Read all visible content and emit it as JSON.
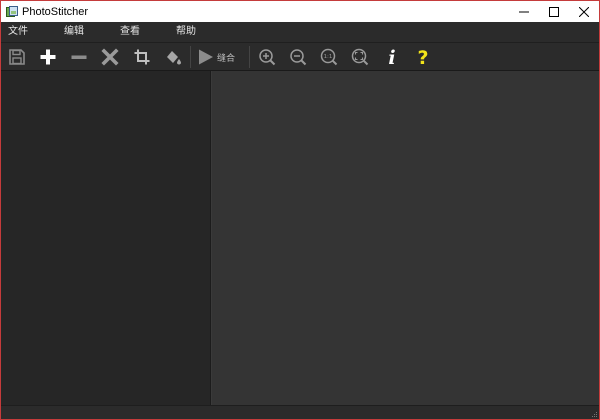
{
  "window": {
    "title": "PhotoStitcher"
  },
  "menu": {
    "items": [
      "文件",
      "编辑",
      "查看",
      "帮助"
    ]
  },
  "toolbar": {
    "buttons": [
      {
        "name": "save",
        "icon": "floppy-disk-icon"
      },
      {
        "name": "add",
        "icon": "plus-icon"
      },
      {
        "name": "remove",
        "icon": "minus-icon"
      },
      {
        "name": "delete",
        "icon": "x-icon"
      },
      {
        "name": "crop",
        "icon": "crop-icon"
      },
      {
        "name": "fill",
        "icon": "paint-bucket-icon"
      },
      {
        "name": "stitch",
        "icon": "play-icon",
        "label": "缝合"
      },
      {
        "name": "zoom-in",
        "icon": "zoom-in-icon"
      },
      {
        "name": "zoom-out",
        "icon": "zoom-out-icon"
      },
      {
        "name": "actual-size",
        "icon": "zoom-1to1-icon",
        "label": "1:1"
      },
      {
        "name": "fit",
        "icon": "zoom-fit-icon"
      },
      {
        "name": "info",
        "icon": "info-icon",
        "label": "i"
      },
      {
        "name": "help",
        "icon": "question-icon",
        "label": "?"
      }
    ]
  },
  "colors": {
    "background": "#2b2b2b",
    "canvas": "#343434",
    "left_panel": "#262626",
    "window_border": "#c53b3b",
    "help_yellow": "#f2e41a"
  }
}
